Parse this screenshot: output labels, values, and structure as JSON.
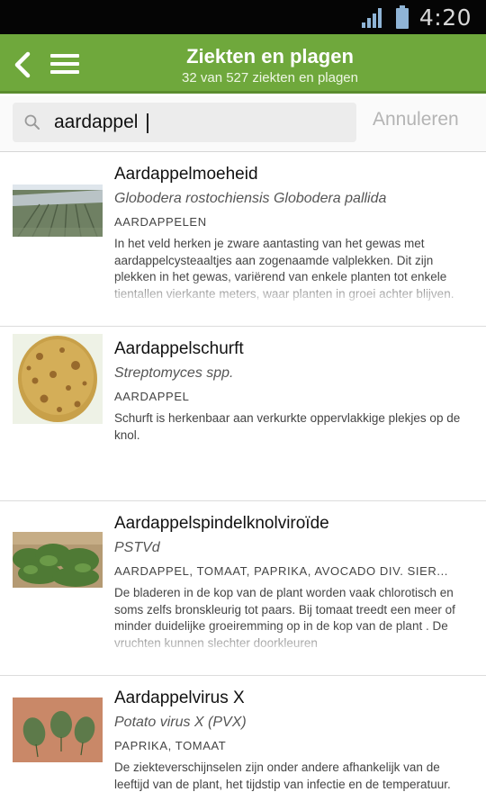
{
  "status_bar": {
    "time": "4:20",
    "signal_icon": "signal-icon",
    "battery_icon": "battery-icon"
  },
  "header": {
    "title": "Ziekten en plagen",
    "subtitle": "32 van 527 ziekten en plagen",
    "back_icon": "back-arrow-icon",
    "menu_icon": "hamburger-menu-icon",
    "color": "#6fa83c"
  },
  "search": {
    "value": "aardappel",
    "cancel_label": "Annuleren",
    "icon": "search-icon"
  },
  "items": [
    {
      "name": "Aardappelmoeheid",
      "latin": "Globodera rostochiensis Globodera pallida",
      "crops": "AARDAPPELEN",
      "description": "In het veld herken je zware aantasting van het gewas met aardappelcysteaaltjes aan zogenaamde valplekken. Dit zijn plekken in het gewas, variërend van enkele planten tot enkele tientallen vierkante meters, waar planten in groei achter blijven.",
      "thumb": "field-photo"
    },
    {
      "name": "Aardappelschurft",
      "latin": "Streptomyces spp.",
      "crops": "AARDAPPEL",
      "description": "Schurft is herkenbaar aan verkurkte oppervlakkige plekjes op de knol.",
      "thumb": "potato-photo"
    },
    {
      "name": "Aardappelspindelknolviroïde",
      "latin": "PSTVd",
      "crops": "AARDAPPEL, TOMAAT, PAPRIKA, AVOCADO DIV. SIER...",
      "description": "De bladeren in de kop van de plant worden vaak chlorotisch en soms zelfs bronskleurig tot paars. Bij tomaat treedt een meer of minder duidelijke groeiremming op in de kop van de plant . De vruchten kunnen slechter doorkleuren",
      "thumb": "crop-photo"
    },
    {
      "name": "Aardappelvirus X",
      "latin": "Potato virus X (PVX)",
      "crops": "PAPRIKA, TOMAAT",
      "description": "De ziekteverschijnselen zijn onder andere afhankelijk van de leeftijd van de plant, het tijdstip van infectie en de temperatuur.",
      "thumb": "leaves-photo"
    }
  ]
}
